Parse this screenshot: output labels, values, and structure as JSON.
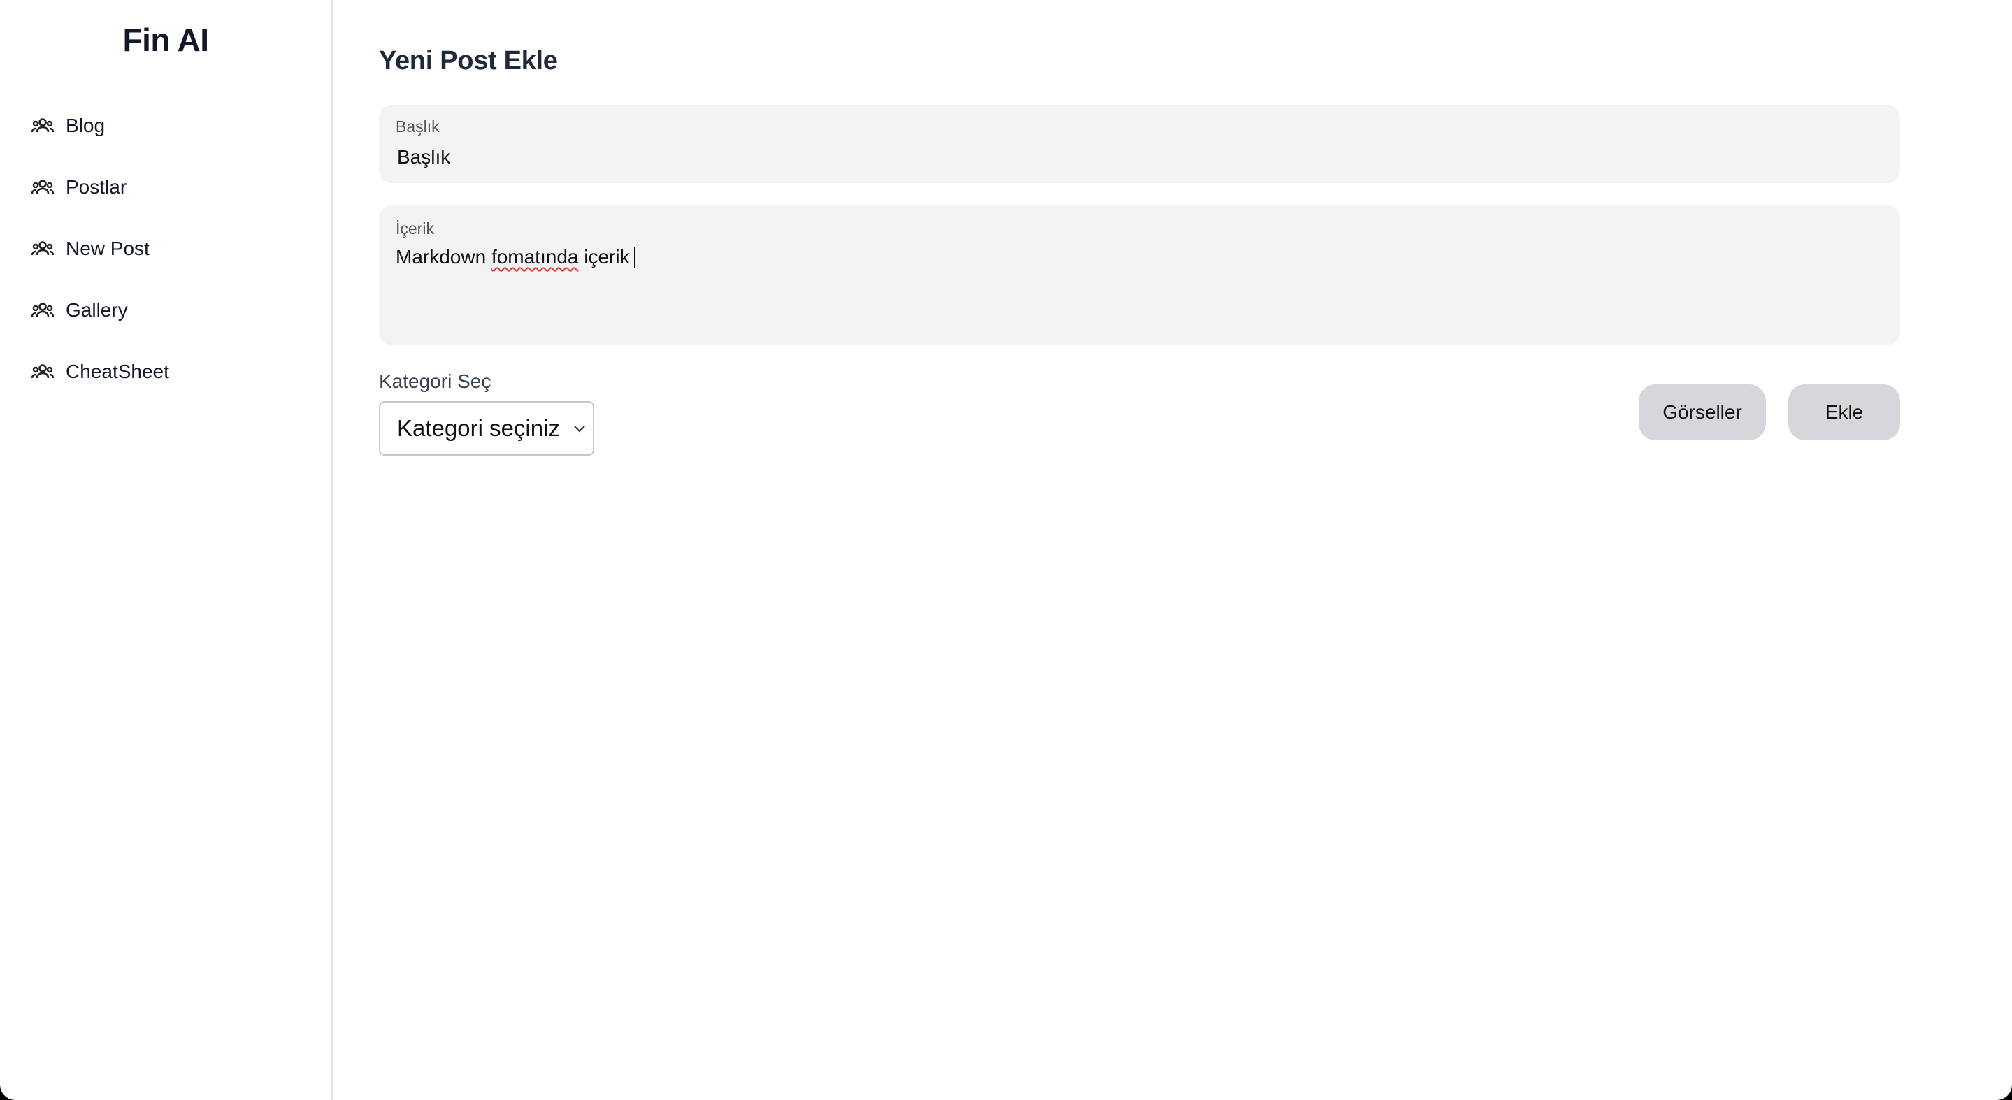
{
  "sidebar": {
    "brand": "Fin AI",
    "items": [
      {
        "label": "Blog",
        "icon": "group-icon"
      },
      {
        "label": "Postlar",
        "icon": "group-icon"
      },
      {
        "label": "New Post",
        "icon": "group-icon"
      },
      {
        "label": "Gallery",
        "icon": "group-icon"
      },
      {
        "label": "CheatSheet",
        "icon": "group-icon"
      }
    ]
  },
  "main": {
    "title": "Yeni Post Ekle",
    "title_field": {
      "label": "Başlık",
      "value": "Başlık"
    },
    "content_field": {
      "label": "İçerik",
      "value_before": "Markdown ",
      "value_misspelled": "fomatında",
      "value_after": " içerik"
    },
    "category": {
      "label": "Kategori Seç",
      "selected": "Kategori seçiniz"
    },
    "buttons": {
      "gallery": "Görseller",
      "add": "Ekle"
    }
  },
  "colors": {
    "field_bg": "#f3f3f3",
    "button_bg": "#d6d6db",
    "spell_error": "#e03131",
    "text": "#111827"
  }
}
